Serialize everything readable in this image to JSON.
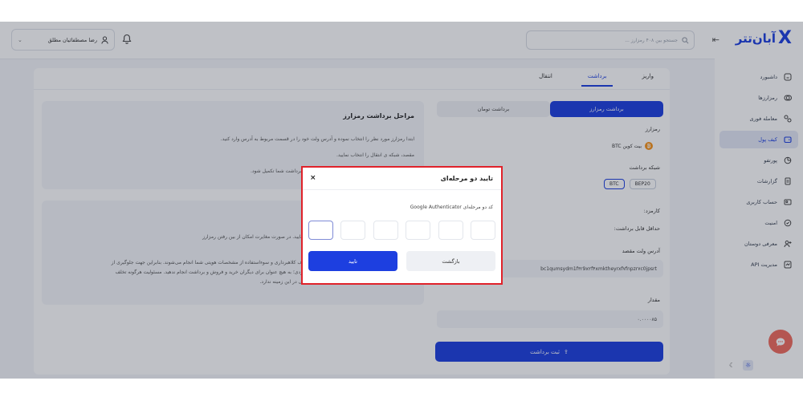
{
  "brand": {
    "logo_text": "آبان‌تتر",
    "logo_mark": "X",
    "color": "#1d3fe0"
  },
  "header": {
    "search_placeholder": "جستجو بین ۴۰۸ رمزارز ...",
    "user_name": "رضا مصطفائیان مطلق"
  },
  "sidebar": {
    "items": [
      {
        "label": "داشبورد",
        "icon": "home-icon"
      },
      {
        "label": "رمزارزها",
        "icon": "coins-icon"
      },
      {
        "label": "معامله فوری",
        "icon": "exchange-icon"
      },
      {
        "label": "کیف پول",
        "icon": "wallet-icon",
        "active": true
      },
      {
        "label": "پورتفو",
        "icon": "pie-chart-icon"
      },
      {
        "label": "گزارشات",
        "icon": "report-icon"
      },
      {
        "label": "حساب کاربری",
        "icon": "user-card-icon"
      },
      {
        "label": "امنیت",
        "icon": "shield-icon"
      },
      {
        "label": "معرفی دوستان",
        "icon": "user-plus-icon"
      },
      {
        "label": "مدیریت API",
        "icon": "api-icon"
      }
    ]
  },
  "tabs": [
    "واریز",
    "برداشت",
    "انتقال"
  ],
  "withdraw": {
    "segments": [
      "برداشت رمزارز",
      "برداشت تومان"
    ],
    "crypto_label": "رمزارز",
    "coin_name": "بیت کوین BTC",
    "network_label": "شبکه برداشت",
    "networks": [
      "BEP20",
      "BTC"
    ],
    "fee_label": "کارمزد:",
    "min_label": "حداقل قابل برداشت:",
    "address_label": "آدرس ولت مقصد",
    "address_value": "bc1qumsydm1f۳r9x۲f۴xmktheyrxf۷fnpzr۷c0jpsrt",
    "amount_label": "مقدار",
    "amount_value": "۰.۰۰۰۰۸۵",
    "submit": "ثبت برداشت"
  },
  "steps": {
    "title": "مراحل برداشت رمزارز",
    "lines": [
      "ابتدا رمزارز مورد نظر را انتخاب نموده و آدرس ولت خود را در قسمت مربوط به آدرس وارد کنید.",
      "مقصد، شبکه ی انتقال را انتخاب نمایید.",
      "رد کنید. در نهایت ثبت برداشت را بزنید و منتظر بمانید تا برداشت شما تکمیل شود."
    ]
  },
  "warning": {
    "lines": [
      "شبکه ی انتقال در ولت مبدا و مقصد اطمینان حاصل فرمایید. در صورت مغایرت امکان از بین رفتن رمزارز",
      "کاربر گرامی، آگهی‌های اینترنتی کسب درآمد، کاملا با هدف کلاهبرداری و سوءاستفاده از مشخصات هویتی شما انجام می‌شوند. بنابراین جهت جلوگیری از",
      "مواجه شدن با اتهاماتی نظیر پولشویی، یا مشارکت در دزدی؛ به هیچ عنوان برای دیگران خرید و فروش و برداشت انجام ندهید. مسئولیت هرگونه تخلف",
      "به عهده‌ی صاحب حساب می‌باشد و آبان‌تتر هیچ مسئولیتی در این زمینه ندارد."
    ]
  },
  "modal": {
    "title": "تایید دو مرحله‌ای",
    "label": "کد دو مرحله‌ای Google Authenticator",
    "otp_digits": [
      "",
      "",
      "",
      "",
      "",
      ""
    ],
    "confirm": "تایید",
    "back": "بازگشت"
  }
}
